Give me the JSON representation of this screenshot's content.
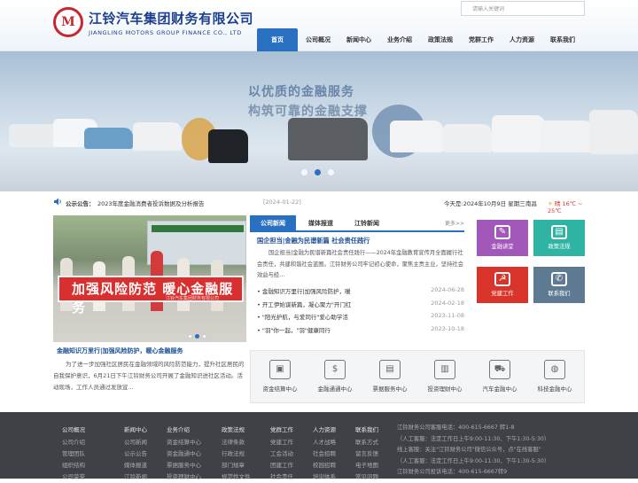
{
  "header": {
    "logo_mark": "M",
    "company_cn": "江铃汽车集团财务有限公司",
    "company_en": "JIANGLING MOTORS GROUP FINANCE CO., LTD",
    "search_placeholder": "请输入关键词"
  },
  "nav": {
    "items": [
      "首页",
      "公司概况",
      "新闻中心",
      "业务介绍",
      "政策法规",
      "党群工作",
      "人力资源",
      "联系我们"
    ],
    "active": 0
  },
  "banner": {
    "slogan_line1": "以优质的金融服务",
    "slogan_line2": "构筑可靠的金融支撑",
    "slide_count": 3,
    "active_slide": 1
  },
  "notice": {
    "label": "公示公告：",
    "text": "2023年度金融消费者投诉数据及分析报告",
    "date": "[2024-01-22]",
    "today": "今天是:2024年10月9日 星期三",
    "city": "南昌",
    "weather": "晴 16℃ ~ 25℃"
  },
  "photo_news": {
    "banner_text": "加强风险防范 暖心金融服务",
    "banner_sub": "江铃汽车集团财务有限公司",
    "title": "金融知识万里行|加强风险防护，暖心金融服务",
    "desc": "为了进一步加强社区居民在金融领域的风险防范能力，提升社区居民的自我保护意识，6月21日下午江铃财务公司开展了金融知识进社区活动。活动现场，工作人员通过发放宣..."
  },
  "news_tabs": {
    "tabs": [
      "公司新闻",
      "媒体报道",
      "江铃新闻"
    ],
    "more": "更多>>",
    "lead_title": "国企担当|金融为民谱新篇 社会责任践行",
    "lead_text": "国企担当|金融为民谱新篇社会责任践行——2024年金融教育宣传月全面履行社会责任，共建和谐社会蓝图。江铃财务公司牢记初心使命，聚焦主责主业，坚持社会效益与经...",
    "items": [
      {
        "title": "金融知识万里行|加强风险防护，暖",
        "date": "2024-06-28"
      },
      {
        "title": "开工伊始谋新篇，凝心聚力\"开门红",
        "date": "2024-02-18"
      },
      {
        "title": "\"阳光护航，与爱同行\"爱心助学活",
        "date": "2023-11-08"
      },
      {
        "title": "\"羽\"你一起，\"羽\"健康同行",
        "date": "2023-10-18"
      }
    ]
  },
  "quick_links": [
    {
      "label": "金融讲堂",
      "icon": "book-icon",
      "glyph": "✎",
      "color": "#a258b8"
    },
    {
      "label": "政策法规",
      "icon": "ticket-icon",
      "glyph": "▤",
      "color": "#2fb3a3"
    },
    {
      "label": "党建工作",
      "icon": "party-icon",
      "glyph": "☭",
      "color": "#d9342b"
    },
    {
      "label": "联系我们",
      "icon": "phone-icon",
      "glyph": "✆",
      "color": "#5e7a93"
    }
  ],
  "services": [
    {
      "label": "资金结算中心",
      "icon": "monitor-icon",
      "glyph": "▣"
    },
    {
      "label": "金融通通中心",
      "icon": "coins-icon",
      "glyph": "$"
    },
    {
      "label": "票据服务中心",
      "icon": "document-icon",
      "glyph": "▤"
    },
    {
      "label": "投资理财中心",
      "icon": "chart-icon",
      "glyph": "▥"
    },
    {
      "label": "汽车金融中心",
      "icon": "truck-icon",
      "glyph": "⛟"
    },
    {
      "label": "科技金融中心",
      "icon": "globe-icon",
      "glyph": "◍"
    }
  ],
  "footer": {
    "columns": [
      {
        "heading": "公司概况",
        "items": [
          "公司介绍",
          "管理团队",
          "组织结构",
          "公司荣誉"
        ]
      },
      {
        "heading": "新闻中心",
        "items": [
          "公司新闻",
          "公示公告",
          "媒体报道",
          "江铃新闻"
        ]
      },
      {
        "heading": "业务介绍",
        "items": [
          "资金结算中心",
          "资金融通中心",
          "票据服务中心",
          "投资理财中心"
        ]
      },
      {
        "heading": "政策法规",
        "items": [
          "法律条款",
          "行政法规",
          "部门规章",
          "规范性文件"
        ]
      },
      {
        "heading": "党群工作",
        "items": [
          "党建工作",
          "工会活动",
          "团建工作",
          "社会责任"
        ]
      },
      {
        "heading": "人力资源",
        "items": [
          "人才战略",
          "社会招聘",
          "校园招聘",
          "培训体系"
        ]
      },
      {
        "heading": "联系我们",
        "items": [
          "联系方式",
          "留言反馈",
          "电子地图",
          "常见问题"
        ]
      }
    ],
    "contact": [
      "江铃财务公司客服电话：400-615-6667 转1-8",
      "（人工客服：法定工作日上午9:00-11:30、下午1:30-5:30）",
      "线上客服：关注\"江铃财务公司\"微信公众号，点\"在线客服\"",
      "（人工客服：法定工作日上午9:00-11:30、下午1:30-5:30）",
      "江铃财务公司投诉电话：400-615-6667转9"
    ]
  }
}
